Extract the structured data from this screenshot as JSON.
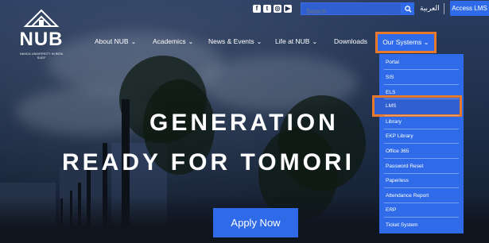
{
  "topbar": {
    "social_icons": [
      "facebook-icon",
      "twitter-icon",
      "instagram-icon",
      "youtube-icon"
    ],
    "search_placeholder": "Search",
    "language": "العربية",
    "access_button": "Access LMS"
  },
  "logo": {
    "text": "NUB",
    "subtitle": "NAHDA UNIVERSITY IN BENI SUEF"
  },
  "nav": {
    "items": [
      {
        "label": "About NUB",
        "has_dropdown": true
      },
      {
        "label": "Academics",
        "has_dropdown": true
      },
      {
        "label": "News & Events",
        "has_dropdown": true
      },
      {
        "label": "Life at NUB",
        "has_dropdown": true
      },
      {
        "label": "Downloads",
        "has_dropdown": false
      },
      {
        "label": "Our Systems",
        "has_dropdown": true,
        "active": true
      }
    ]
  },
  "dropdown": {
    "items": [
      "Portal",
      "SIS",
      "ELS",
      "LMS",
      "Library",
      "EKP Library",
      "Office 365",
      "Password Reset",
      "Paperless",
      "Attendance Report",
      "ERP",
      "Ticket System"
    ],
    "highlighted": "LMS"
  },
  "hero": {
    "line1": "GENERATION",
    "line2": "READY FOR TOMORI",
    "cta": "Apply Now"
  },
  "colors": {
    "accent": "#2f6be8",
    "highlight_border": "#e8782a",
    "text": "#ffffff"
  }
}
